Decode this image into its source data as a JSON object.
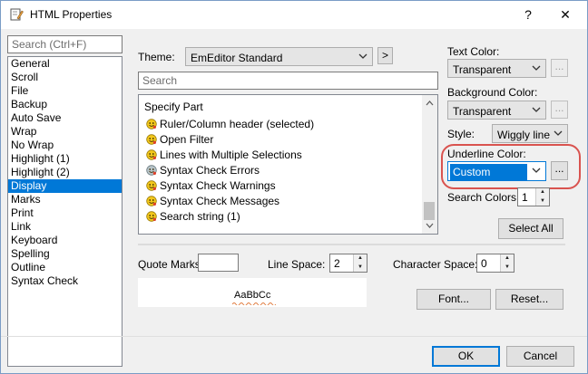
{
  "window": {
    "title": "HTML Properties",
    "help_glyph": "?",
    "close_glyph": "✕"
  },
  "search": {
    "placeholder": "Search (Ctrl+F)"
  },
  "categories": {
    "items": [
      "General",
      "Scroll",
      "File",
      "Backup",
      "Auto Save",
      "Wrap",
      "No Wrap",
      "Highlight (1)",
      "Highlight (2)",
      "Display",
      "Marks",
      "Print",
      "Link",
      "Keyboard",
      "Spelling",
      "Outline",
      "Syntax Check"
    ],
    "selected": "Display"
  },
  "theme": {
    "label": "Theme:",
    "value": "EmEditor Standard",
    "more_label": ">"
  },
  "part_search": {
    "placeholder": "Search"
  },
  "parts": {
    "header": "Specify Part",
    "items": [
      "Ruler/Column header (selected)",
      "Open Filter",
      "Lines with Multiple Selections",
      "Syntax Check Errors",
      "Syntax Check Warnings",
      "Syntax Check Messages",
      "Search string (1)"
    ]
  },
  "text_color": {
    "label": "Text Color:",
    "value": "Transparent",
    "more_label": "..."
  },
  "background_color": {
    "label": "Background Color:",
    "value": "Transparent",
    "more_label": "..."
  },
  "style": {
    "label": "Style:",
    "value": "Wiggly line"
  },
  "underline_color": {
    "label": "Underline Color:",
    "value": "Custom",
    "more_label": "..."
  },
  "search_colors": {
    "label": "Search Colors:",
    "value": "1"
  },
  "select_all": {
    "label": "Select All"
  },
  "quote_marks": {
    "label": "Quote Marks:",
    "value": ""
  },
  "line_space": {
    "label": "Line Space:",
    "value": "2"
  },
  "character_space": {
    "label": "Character Space:",
    "value": "0"
  },
  "preview": {
    "text": "AaBbCc"
  },
  "font_button": {
    "label": "Font..."
  },
  "reset_button": {
    "label": "Reset..."
  },
  "ok_button": {
    "label": "OK"
  },
  "cancel_button": {
    "label": "Cancel"
  },
  "colors": {
    "accent": "#0078d7",
    "highlight_oval": "#d9534f",
    "wiggle": "#e07a3c"
  },
  "icons": {
    "title": "edit-document-icon",
    "part": "smiley-face-icon",
    "dropdown": "chevron-down-icon"
  }
}
